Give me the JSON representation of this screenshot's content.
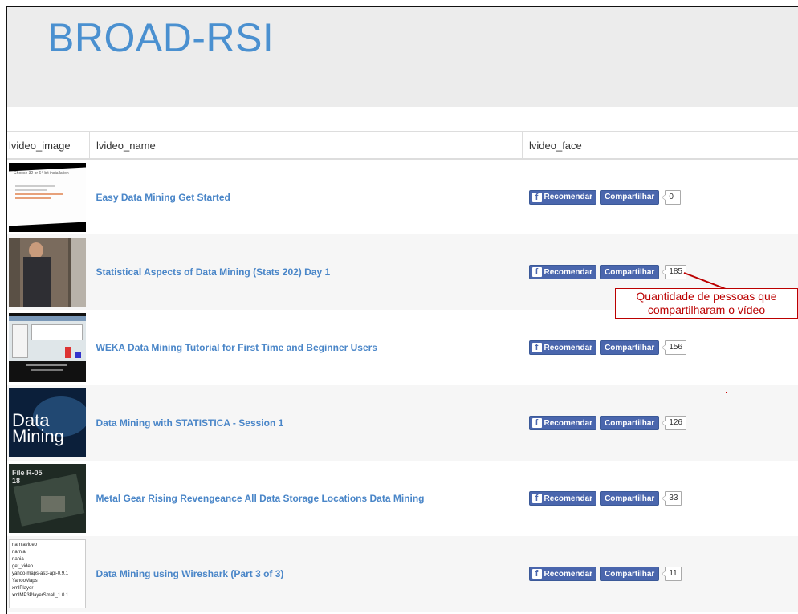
{
  "header": {
    "title": "BROAD-RSI"
  },
  "table": {
    "columns": [
      "lvideo_image",
      "lvideo_name",
      "lvideo_face"
    ],
    "rows": [
      {
        "name": "Easy Data Mining Get Started",
        "thumb_text": "Choose 32 or 64 bit installation",
        "recommend": "Recomendar",
        "share": "Compartilhar",
        "count": "0"
      },
      {
        "name": "Statistical Aspects of Data Mining (Stats 202) Day 1",
        "thumb_text": "",
        "recommend": "Recomendar",
        "share": "Compartilhar",
        "count": "185"
      },
      {
        "name": "WEKA Data Mining Tutorial for First Time and Beginner Users",
        "thumb_text": "",
        "recommend": "Recomendar",
        "share": "Compartilhar",
        "count": "156"
      },
      {
        "name": "Data Mining with STATISTICA - Session 1",
        "thumb_text": "Data Mining",
        "recommend": "Recomendar",
        "share": "Compartilhar",
        "count": "126"
      },
      {
        "name": "Metal Gear Rising Revengeance All Data Storage Locations Data Mining",
        "thumb_text": "File R-05|18",
        "recommend": "Recomendar",
        "share": "Compartilhar",
        "count": "33"
      },
      {
        "name": "Data Mining using Wireshark (Part 3 of 3)",
        "thumb_text": "narniavideo|narnia|nania|get_video|yahoo-maps-as3-api-0.9.1|YahooMaps|xmlPlayer|xmlMP3PlayerSmall_1.0.1",
        "recommend": "Recomendar",
        "share": "Compartilhar",
        "count": "11"
      }
    ]
  },
  "annotation": {
    "line1": "Quantidade de pessoas que",
    "line2": "compartilharam o vídeo"
  },
  "colors": {
    "accent": "#4a90d0",
    "link": "#4a86c8",
    "facebook": "#4a66ad",
    "annotation": "#b00000"
  }
}
